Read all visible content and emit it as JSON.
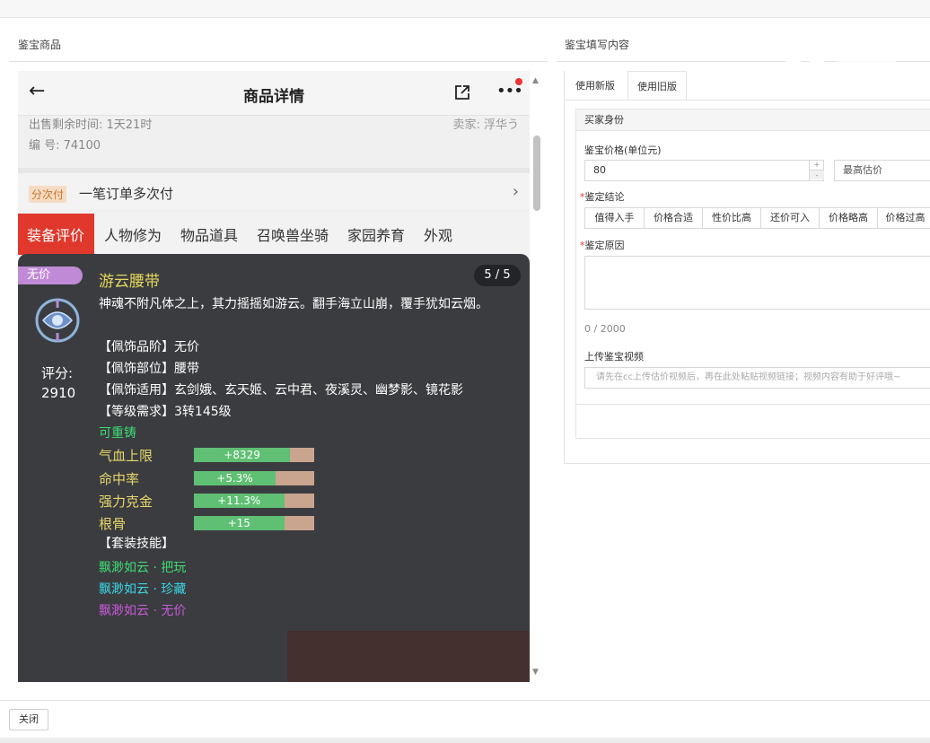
{
  "left_section_title": "鉴宝商品",
  "right_section_title": "鉴宝填写内容",
  "phone": {
    "header_title": "商品详情",
    "sale_time": "出售剩余时间: 1天21时",
    "seller": "卖家: 浮华う",
    "serial": "编 号: 74100",
    "split_badge": "分次付",
    "split_text": "一笔订单多次付",
    "tabs": [
      "装备评价",
      "人物修为",
      "物品道具",
      "召唤兽坐骑",
      "家园养育",
      "外观"
    ],
    "active_tab": "装备评价"
  },
  "item": {
    "price_tag": "无价",
    "name": "游云腰带",
    "count": "5 / 5",
    "score_label": "评分:",
    "score_value": "2910",
    "description": "神魂不附凡体之上，其力摇摇如游云。翻手海立山崩，覆手犹如云烟。",
    "grade": "【佩饰品阶】无价",
    "slot": "【佩饰部位】腰带",
    "applicable": "【佩饰适用】玄剑娥、玄天姬、云中君、夜溪灵、幽梦影、镜花影",
    "level_req": "【等级需求】3转145级",
    "recastable": "可重铸",
    "stats": [
      {
        "label": "气血上限",
        "value": "+8329",
        "fill_fraction": 0.8
      },
      {
        "label": "命中率",
        "value": "+5.3%",
        "fill_fraction": 0.68
      },
      {
        "label": "强力克金",
        "value": "+11.3%",
        "fill_fraction": 0.75
      },
      {
        "label": "根骨",
        "value": "+15",
        "fill_fraction": 0.75
      }
    ],
    "set_skill_header": "【套装技能】",
    "set_skills": [
      {
        "text": "飘渺如云 · 把玩",
        "color": "#3ddc73"
      },
      {
        "text": "飘渺如云 · 珍藏",
        "color": "#3ad7e6"
      },
      {
        "text": "飘渺如云 · 无价",
        "color": "#c85ad8"
      }
    ]
  },
  "form": {
    "tabs": [
      "使用新版",
      "使用旧版"
    ],
    "active_tab": "使用旧版",
    "header": "买家身份",
    "price_label": "鉴宝价格(单位元)",
    "price_value": "80",
    "estimate_select": "最高估价",
    "conclusion_label": "鉴定结论",
    "conclusions": [
      "值得入手",
      "价格合适",
      "性价比高",
      "还价可入",
      "价格略高",
      "价格过高"
    ],
    "reason_label": "鉴定原因",
    "reason_counter": "0 / 2000",
    "video_label": "上传鉴宝视频",
    "video_placeholder": "请先在cc上传估价视频后，再在此处粘贴视频链接；视频内容有助于好评哦~"
  },
  "close_button": "关闭",
  "colors": {
    "accent_red": "#e0382c",
    "bar_green": "#5fbf73",
    "item_name_yellow": "#e6d85a",
    "card_bg": "#3b3c40"
  }
}
